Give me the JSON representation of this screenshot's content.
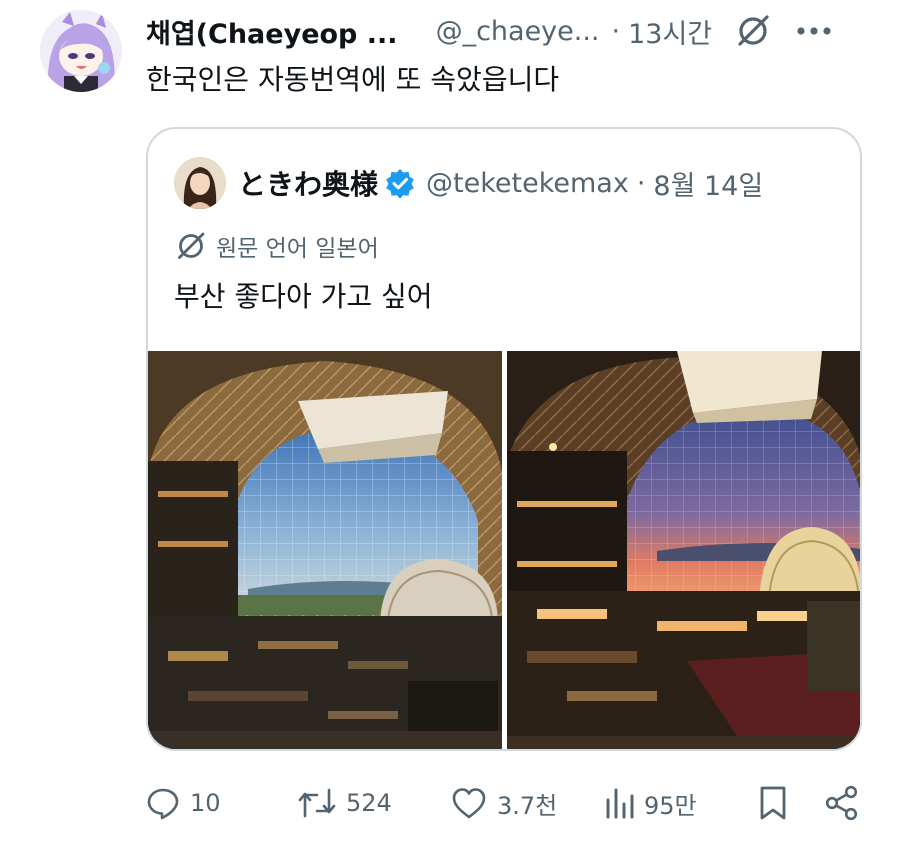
{
  "post": {
    "author_name": "채엽(Chaeyeop ...",
    "author_handle": "@_chaeye...",
    "separator": "·",
    "time": "13시간",
    "text": "한국인은 자동번역에 또 속았읍니다"
  },
  "quote": {
    "author_name": "ときわ奥様",
    "author_handle": "@teketekemax",
    "separator": "·",
    "date": "8월 14일",
    "translation_note": "원문 언어 일본어",
    "text": "부산 좋다아 가고 싶어"
  },
  "actions": {
    "replies": "10",
    "reposts": "524",
    "likes": "3.7천",
    "views": "95만"
  },
  "icons": {
    "translate": "translate-icon",
    "more": "more-icon",
    "verified": "verified-badge-icon",
    "reply": "reply-icon",
    "repost": "repost-icon",
    "like": "heart-icon",
    "views": "analytics-icon",
    "bookmark": "bookmark-icon",
    "share": "share-icon"
  },
  "colors": {
    "text": "#0f1419",
    "secondary": "#536471",
    "border": "#cfd9de",
    "verified": "#1d9bf0"
  }
}
